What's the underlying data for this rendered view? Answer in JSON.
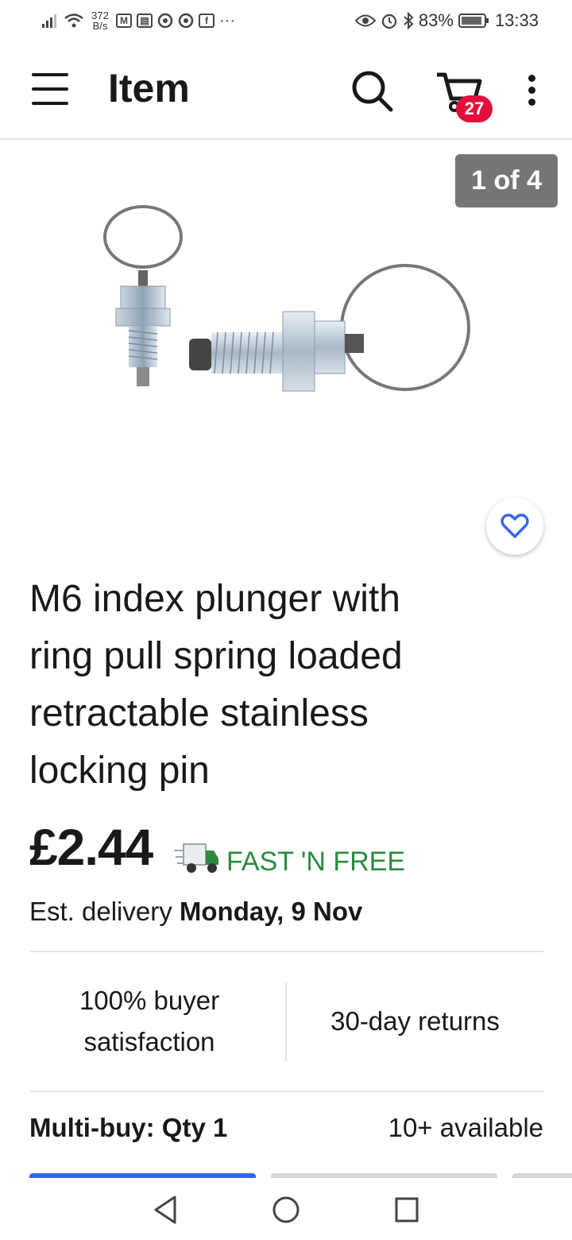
{
  "status_bar": {
    "net_speed_value": "372",
    "net_speed_unit": "B/s",
    "battery": "83%",
    "time": "13:33",
    "icons": [
      "signal-icon",
      "wifi-icon",
      "gmail-icon",
      "calendar-icon",
      "chrome-icon",
      "chrome-icon",
      "facebook-icon",
      "more-notifications-icon",
      "eye-icon",
      "alarm-icon",
      "bluetooth-icon",
      "battery-icon"
    ]
  },
  "app_bar": {
    "title": "Item",
    "cart_count": "27",
    "icons": [
      "menu-icon",
      "search-icon",
      "cart-icon",
      "more-vert-icon"
    ]
  },
  "gallery": {
    "counter": "1 of 4",
    "favorite_icon": "heart-outline-icon"
  },
  "product": {
    "title": "M6 index plunger with ring pull spring loaded retractable stainless locking pin",
    "price": "£2.44",
    "shipping": "FAST 'N FREE",
    "delivery_prefix": "Est. delivery",
    "delivery_date": "Monday, 9 Nov"
  },
  "trust": {
    "satisfaction": "100% buyer satisfaction",
    "returns": "30-day returns"
  },
  "purchase": {
    "multibuy": "Multi-buy: Qty 1",
    "available": "10+ available"
  },
  "colors": {
    "accent_blue": "#3665f3",
    "badge_red": "#e0103a",
    "shipping_green": "#2b8a3e",
    "counter_grey": "#767676"
  },
  "nav_bar": {
    "icons": [
      "back-icon",
      "home-icon",
      "recents-icon"
    ]
  }
}
